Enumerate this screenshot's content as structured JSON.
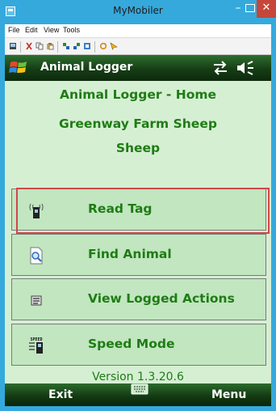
{
  "window": {
    "title": "MyMobiler",
    "min_glyph": "–",
    "close_glyph": "✕"
  },
  "menubar": {
    "items": [
      "File",
      "Edit",
      "View",
      "Tools"
    ]
  },
  "toolbar": {
    "icons": [
      "screen-icon",
      "cut-icon",
      "copy-icon",
      "paste-icon",
      "copy-to-device-icon",
      "copy-from-device-icon",
      "clipboard-icon",
      "refresh-icon",
      "pointer-icon"
    ]
  },
  "device": {
    "app_title": "Animal Logger",
    "home_title": "Animal Logger - Home",
    "farm_name": "Greenway Farm Sheep",
    "species": "Sheep",
    "buttons": [
      {
        "label": "Read Tag",
        "icon": "rfid-reader-icon"
      },
      {
        "label": "Find Animal",
        "icon": "find-document-icon"
      },
      {
        "label": "View Logged Actions",
        "icon": "log-list-icon"
      },
      {
        "label": "Speed Mode",
        "icon": "speed-mode-icon"
      }
    ],
    "version": "Version 1.3.20.6",
    "softkeys": {
      "left": "Exit",
      "right": "Menu"
    },
    "speed_icon_text": "SPEED"
  },
  "colors": {
    "window_frame": "#35a9dc",
    "app_green_text": "#1f7c14",
    "content_bg": "#d5efd3",
    "button_bg": "#c1e6c0",
    "focus_border": "#d04848"
  }
}
